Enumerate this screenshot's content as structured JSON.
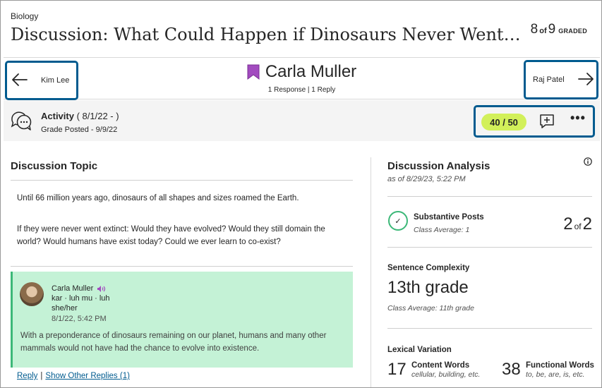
{
  "header": {
    "course": "Biology",
    "title": "Discussion: What Could Happen if Dinosaurs Never Went Exti...",
    "graded_count": "8",
    "graded_of": "of",
    "graded_total": "9",
    "graded_label": "GRADED"
  },
  "student_nav": {
    "prev_student": "Kim Lee",
    "next_student": "Raj Patel",
    "current_student": "Carla Muller",
    "current_meta": "1 Response | 1 Reply"
  },
  "activity": {
    "label": "Activity",
    "dates": "( 8/1/22 - )",
    "grade_posted": "Grade Posted - 9/9/22",
    "grade": "40",
    "grade_sep": "/",
    "grade_max": "50",
    "more_label": "•••"
  },
  "topic": {
    "heading": "Discussion Topic",
    "paragraph1": "Until 66 million years ago, dinosaurs of all shapes and sizes roamed the Earth.",
    "paragraph2": "If they were never went extinct: Would they have evolved? Would they still domain the world? Would humans have exist today? Could we ever learn to co-exist?"
  },
  "post": {
    "author": "Carla Muller",
    "pronunciation": "kar · luh mu · luh",
    "pronouns": "she/her",
    "date": "8/1/22, 5:42 PM",
    "body": "With a preponderance of dinosaurs remaining on our planet, humans and many other mammals would not have had the chance to evolve into existence.",
    "reply_link": "Reply",
    "separator": "|",
    "show_replies_link": "Show Other Replies (1)"
  },
  "analysis": {
    "heading": "Discussion Analysis",
    "as_of": "as of 8/29/23, 5:22 PM",
    "substantive": {
      "label": "Substantive Posts",
      "class_avg": "Class Average: 1",
      "value": "2",
      "of": "of",
      "total": "2"
    },
    "sentence_complexity": {
      "label": "Sentence Complexity",
      "value": "13th grade",
      "class_avg": "Class Average: 11th grade"
    },
    "lexical": {
      "label": "Lexical Variation",
      "content_count": "17",
      "content_label": "Content Words",
      "content_examples": "cellular, building, etc.",
      "functional_count": "38",
      "functional_label": "Functional Words",
      "functional_examples": "to, be, are, is, etc."
    }
  },
  "colors": {
    "focus_outline": "#005b8f",
    "grade_pill": "#d2f05a",
    "post_bg": "#c4f2d6",
    "post_border": "#3cb878",
    "bookmark": "#a24bbf"
  }
}
